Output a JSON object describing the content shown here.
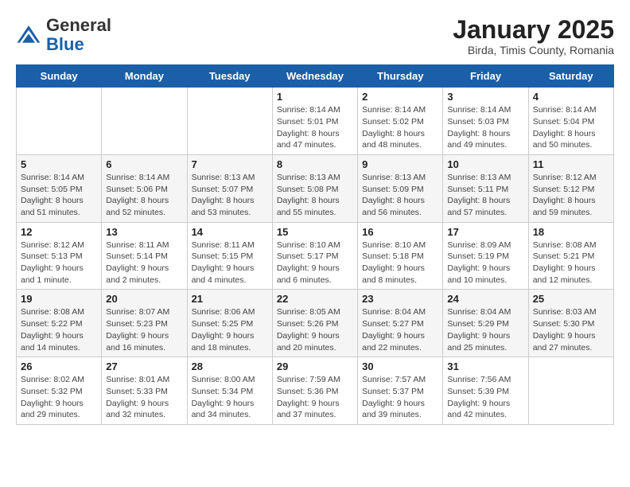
{
  "header": {
    "logo_general": "General",
    "logo_blue": "Blue",
    "month_title": "January 2025",
    "subtitle": "Birda, Timis County, Romania"
  },
  "weekdays": [
    "Sunday",
    "Monday",
    "Tuesday",
    "Wednesday",
    "Thursday",
    "Friday",
    "Saturday"
  ],
  "weeks": [
    [
      {
        "day": "",
        "info": ""
      },
      {
        "day": "",
        "info": ""
      },
      {
        "day": "",
        "info": ""
      },
      {
        "day": "1",
        "info": "Sunrise: 8:14 AM\nSunset: 5:01 PM\nDaylight: 8 hours and 47 minutes."
      },
      {
        "day": "2",
        "info": "Sunrise: 8:14 AM\nSunset: 5:02 PM\nDaylight: 8 hours and 48 minutes."
      },
      {
        "day": "3",
        "info": "Sunrise: 8:14 AM\nSunset: 5:03 PM\nDaylight: 8 hours and 49 minutes."
      },
      {
        "day": "4",
        "info": "Sunrise: 8:14 AM\nSunset: 5:04 PM\nDaylight: 8 hours and 50 minutes."
      }
    ],
    [
      {
        "day": "5",
        "info": "Sunrise: 8:14 AM\nSunset: 5:05 PM\nDaylight: 8 hours and 51 minutes."
      },
      {
        "day": "6",
        "info": "Sunrise: 8:14 AM\nSunset: 5:06 PM\nDaylight: 8 hours and 52 minutes."
      },
      {
        "day": "7",
        "info": "Sunrise: 8:13 AM\nSunset: 5:07 PM\nDaylight: 8 hours and 53 minutes."
      },
      {
        "day": "8",
        "info": "Sunrise: 8:13 AM\nSunset: 5:08 PM\nDaylight: 8 hours and 55 minutes."
      },
      {
        "day": "9",
        "info": "Sunrise: 8:13 AM\nSunset: 5:09 PM\nDaylight: 8 hours and 56 minutes."
      },
      {
        "day": "10",
        "info": "Sunrise: 8:13 AM\nSunset: 5:11 PM\nDaylight: 8 hours and 57 minutes."
      },
      {
        "day": "11",
        "info": "Sunrise: 8:12 AM\nSunset: 5:12 PM\nDaylight: 8 hours and 59 minutes."
      }
    ],
    [
      {
        "day": "12",
        "info": "Sunrise: 8:12 AM\nSunset: 5:13 PM\nDaylight: 9 hours and 1 minute."
      },
      {
        "day": "13",
        "info": "Sunrise: 8:11 AM\nSunset: 5:14 PM\nDaylight: 9 hours and 2 minutes."
      },
      {
        "day": "14",
        "info": "Sunrise: 8:11 AM\nSunset: 5:15 PM\nDaylight: 9 hours and 4 minutes."
      },
      {
        "day": "15",
        "info": "Sunrise: 8:10 AM\nSunset: 5:17 PM\nDaylight: 9 hours and 6 minutes."
      },
      {
        "day": "16",
        "info": "Sunrise: 8:10 AM\nSunset: 5:18 PM\nDaylight: 9 hours and 8 minutes."
      },
      {
        "day": "17",
        "info": "Sunrise: 8:09 AM\nSunset: 5:19 PM\nDaylight: 9 hours and 10 minutes."
      },
      {
        "day": "18",
        "info": "Sunrise: 8:08 AM\nSunset: 5:21 PM\nDaylight: 9 hours and 12 minutes."
      }
    ],
    [
      {
        "day": "19",
        "info": "Sunrise: 8:08 AM\nSunset: 5:22 PM\nDaylight: 9 hours and 14 minutes."
      },
      {
        "day": "20",
        "info": "Sunrise: 8:07 AM\nSunset: 5:23 PM\nDaylight: 9 hours and 16 minutes."
      },
      {
        "day": "21",
        "info": "Sunrise: 8:06 AM\nSunset: 5:25 PM\nDaylight: 9 hours and 18 minutes."
      },
      {
        "day": "22",
        "info": "Sunrise: 8:05 AM\nSunset: 5:26 PM\nDaylight: 9 hours and 20 minutes."
      },
      {
        "day": "23",
        "info": "Sunrise: 8:04 AM\nSunset: 5:27 PM\nDaylight: 9 hours and 22 minutes."
      },
      {
        "day": "24",
        "info": "Sunrise: 8:04 AM\nSunset: 5:29 PM\nDaylight: 9 hours and 25 minutes."
      },
      {
        "day": "25",
        "info": "Sunrise: 8:03 AM\nSunset: 5:30 PM\nDaylight: 9 hours and 27 minutes."
      }
    ],
    [
      {
        "day": "26",
        "info": "Sunrise: 8:02 AM\nSunset: 5:32 PM\nDaylight: 9 hours and 29 minutes."
      },
      {
        "day": "27",
        "info": "Sunrise: 8:01 AM\nSunset: 5:33 PM\nDaylight: 9 hours and 32 minutes."
      },
      {
        "day": "28",
        "info": "Sunrise: 8:00 AM\nSunset: 5:34 PM\nDaylight: 9 hours and 34 minutes."
      },
      {
        "day": "29",
        "info": "Sunrise: 7:59 AM\nSunset: 5:36 PM\nDaylight: 9 hours and 37 minutes."
      },
      {
        "day": "30",
        "info": "Sunrise: 7:57 AM\nSunset: 5:37 PM\nDaylight: 9 hours and 39 minutes."
      },
      {
        "day": "31",
        "info": "Sunrise: 7:56 AM\nSunset: 5:39 PM\nDaylight: 9 hours and 42 minutes."
      },
      {
        "day": "",
        "info": ""
      }
    ]
  ]
}
